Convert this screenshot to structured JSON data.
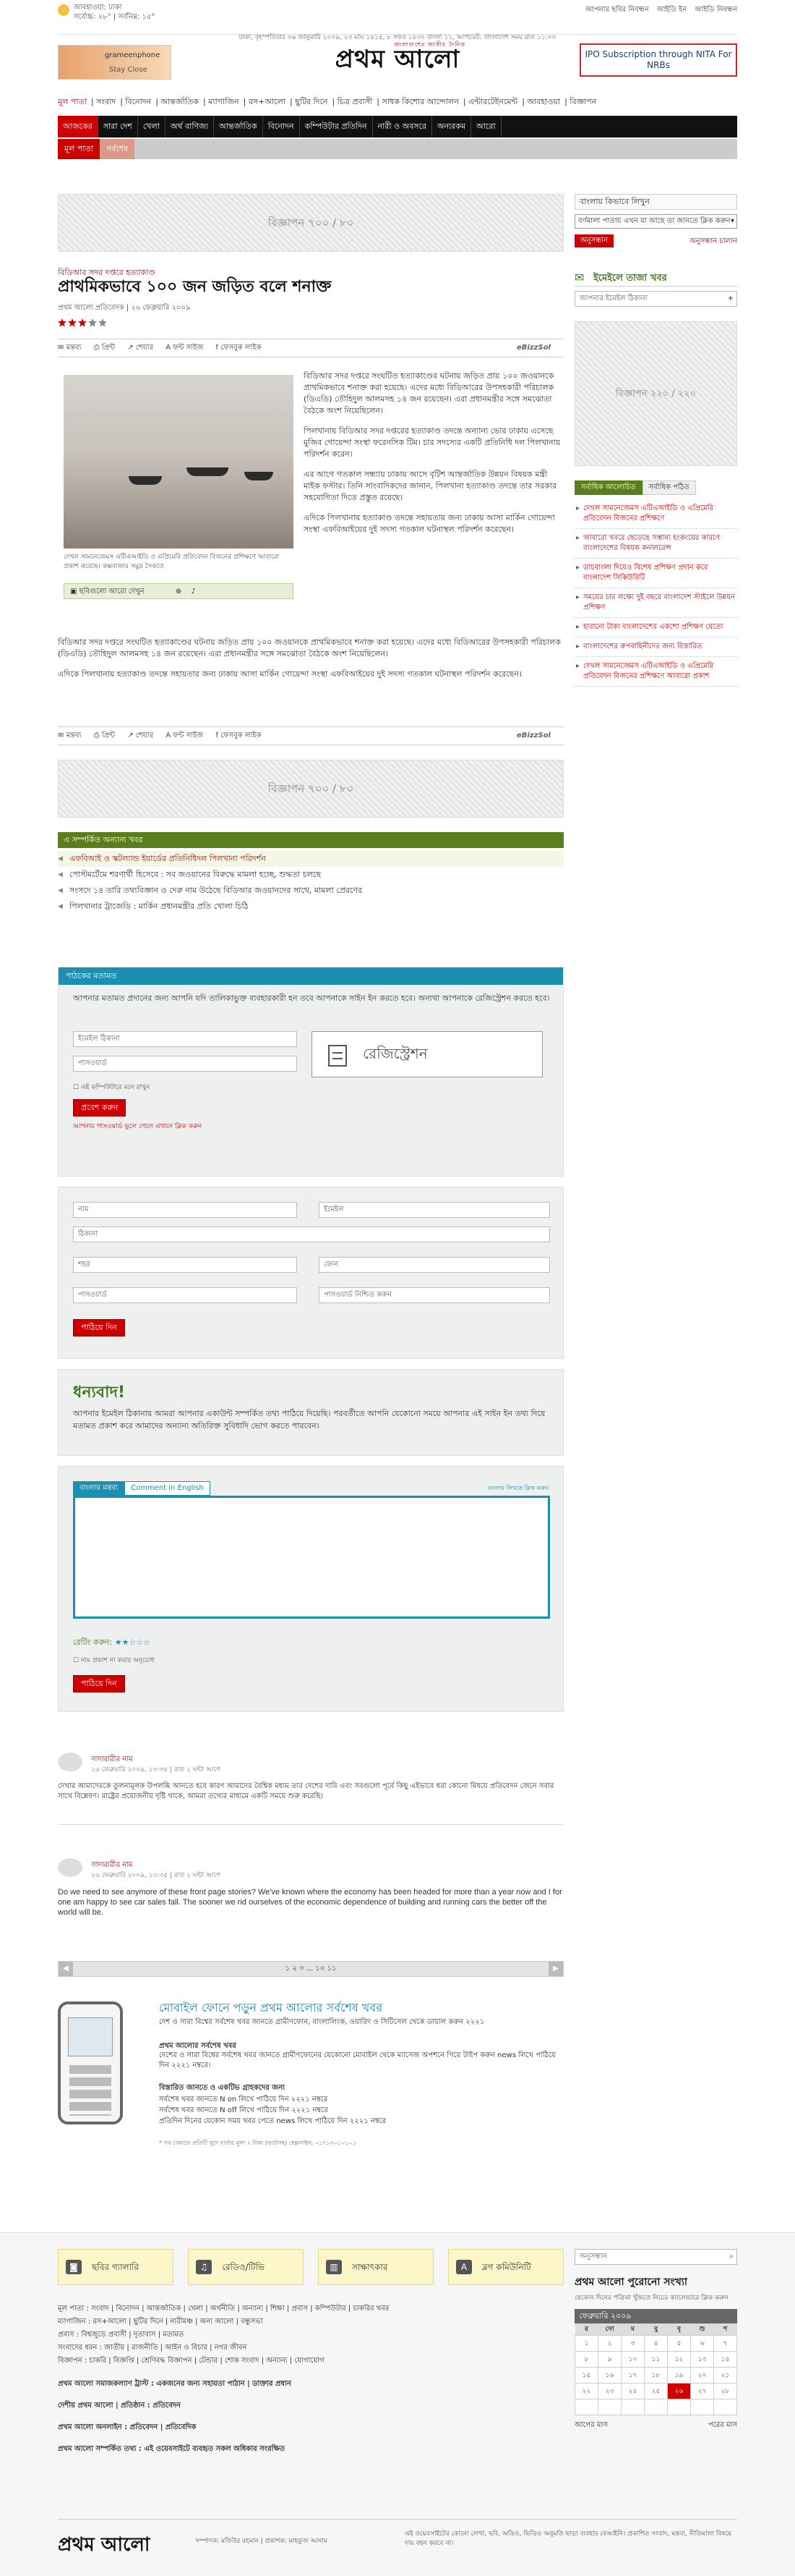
{
  "topbar": {
    "weather_line1": "আবহাওয়া: ঢাকা",
    "weather_line2": "সর্বোচ্চ: ২৮°  |  সর্বনিম্ন: ১৫°",
    "date_line": "ঢাকা, বৃহস্পতিবার ০৬ জানুয়ারি ২০০৯, ২৩ মাঘ ১৪১৫, ৮ সফর ১৪৩০ বাংলা ১১, আপডেট: বাংলাদেশ সময় রাত ১১:০০",
    "links": [
      "আপনার ছবির নিবন্ধন",
      "আইডি ইন",
      "আইডি নিবন্ধন",
      "প্রথম আলো ঢাকা ভিত্তিক"
    ]
  },
  "header": {
    "ad_text1": "grameenphone",
    "ad_text2": "Stay Close",
    "logo": "প্রথম আলো",
    "logo_tag": "বাংলাদেশের জাতীয় দৈনিক",
    "right_banner": "IPO Subscription through NITA For NRBs"
  },
  "subnav": [
    "মূল পাতা",
    "সংবাদ",
    "বিনোদন",
    "আন্তর্জাতিক",
    "ম্যাগাজিন",
    "রস+আলো",
    "ছুটির দিনে",
    "চিত্র প্রবাসী",
    "সাধক কিশোর আন্দোলন",
    "এন্টারটেইনমেন্ট",
    "আবহাওয়া",
    "বিজ্ঞাপন"
  ],
  "mainnav": [
    "আজকের",
    "সারা দেশ",
    "খেলা",
    "অর্থ বাণিজ্য",
    "আন্তর্জাতিক",
    "বিনোদন",
    "কম্পিউটার প্রতিদিন",
    "নারী ও অবসরে",
    "অন্যরকম",
    "আরো"
  ],
  "secnav": [
    "মূল পাতা",
    "সর্বশেষ"
  ],
  "ads": {
    "top": "বিজ্ঞাপন ৭০০ / ৮০",
    "mid": "বিজ্ঞাপন ৭০০ / ৮০",
    "side": "বিজ্ঞাপন ২২০ / ২২০"
  },
  "article": {
    "kicker": "বিডিআর সদর দপ্তরে হত্যাকাণ্ড",
    "title": "প্রাথমিকভাবে ১০০ জন জড়িত বলে শনাক্ত",
    "byline": "প্রথম আলো প্রতিবেদক  |  ২৬ ফেব্রুয়ারি ২০০৯",
    "rating": 3,
    "tools": [
      "মন্তব্য",
      "প্রিন্ট",
      "শেয়ার",
      "ফন্ট সাইজ",
      "ফেসবুক লাইক"
    ],
    "brand": "eBizzSol",
    "para1": "বিডিআর সদর দপ্তরে সংঘটিত হত্যাকাণ্ডের ঘটনায় জড়িত প্রায় ১০০ জওয়ানকে প্রাথমিকভাবে শনাক্ত করা হয়েছে। এদের মধ্যে বিডিআরের উপসহকারী পরিচালক (ডিএডি) তৌহিদুল আলমসহ ১৪ জন রয়েছেন। এরা প্রধানমন্ত্রীর সঙ্গে সমঝোতা বৈঠকে অংশ নিয়েছিলেন।",
    "para2": "পিলখানায় বিডিআর সদর দপ্তরের হত্যাকাণ্ড তদন্তে অন্যান্য ভোর ঢাকায় এসেছে মুজিব গোয়েন্দা সংস্থা ফরেনসিক টিম। চার সদস্যের একটি প্রতিনিধি দল পিলখানায় পরিদর্শন করেন।",
    "para3": "এর আগে গতকাল সন্ধ্যায় ঢাকায় আসে বৃটিশ আন্তর্জাতিক উন্নয়ন বিষয়ক মন্ত্রী মাইক ফস্টার। তিনি সাংবাদিকদের জানান, পিলখানা হত্যাকাণ্ড তদন্তে তার সরকার সহযোগিতা দিতে প্রস্তুত রয়েছে।",
    "para4": "এদিকে পিলখানায় হত্যাকাণ্ড তদন্তে সহায়তায় জন্য ঢাকায় আসা মার্কিন গোয়েন্দা সংস্থা এফবিআইয়ের দুই সদস্য গতকাল ঘটনাস্থল পরিদর্শন করেছেন।",
    "para5": "বিডিআর সদর দপ্তরে সংঘটিত হত্যাকাণ্ডের ঘটনায় জড়িত প্রায় ১০০ জওয়ানকে প্রাথমিকভাবে শনাক্ত করা হয়েছে। এদের মধ্যে বিডিআরের উপসহকারী পরিচালক (ডিএডি) তৌহিদুল আলমসহ ১৪ জন রয়েছেন। এরা প্রধানমন্ত্রীর সঙ্গে সমঝোতা বৈঠকে অংশ নিয়েছিলেন।",
    "para6": "এদিকে পিলখানায় হত্যাকাণ্ড তদন্তে সহায়তার জন্য ঢাকায় আসা মার্কিন গোয়েন্দা সংস্থা এফবিআইয়ের দুই সদস্য গতকাল ঘটনাস্থল পরিদর্শন করেছেন।",
    "image_caption": "দেখল সামনেজেমস এটিএআইডি ও এপ্রিমেরি প্রতিবেদন বিজনের প্রশিক্ষণে আবারো প্রকাশ করেছে। কক্সবাজার সমুদ্র সৈকতে",
    "image_bar": "ছবিগুলো আরো দেখুন"
  },
  "related": {
    "title": "এ সম্পর্কিত অন্যান্য খবর",
    "items": [
      "এফবিআই ও স্কটল্যান্ড ইয়ার্ডের প্রতিনিধিদল পিলখানা পরিদর্শন",
      "পোস্টমর্টেমে শরণার্থী হিসেবে : সব জওয়ানের বিরুদ্ধে মামলা হচ্ছে, শুদ্ধতা চলছে",
      "সংসদে ১৪ তারি তথ্যবিজ্ঞান ও দেরু নাম উঠেছে বিডিআর জওয়ানদের সাথে, মামলা প্রেরণের",
      "পিলখানার ট্রাজেডি : মার্কিন প্রধানমন্ত্রীর প্রতি খোলা চিঠি"
    ]
  },
  "reader": {
    "title": "পাঠকের মতামত",
    "intro": "আপনার মতামত প্রদানের জন্য আপনি যদি তালিকাভুক্ত ব্যবহারকারী হন তবে আপনাকে সাইন ইন করতে হবে। অন্যথা আপনাকে রেজিস্ট্রেশন করতে হবে।",
    "email_ph": "ইমেইল ঠিকানা",
    "password_ph": "পাসওয়ার্ড",
    "remember": "এই কম্পিউটারে মনে রাখুন",
    "submit": "প্রবেশ করুন",
    "forgot": "আপনার পাসওয়ার্ড ভুলে গেলে এখানে ক্লিক করুন",
    "register": "রেজিস্ট্রেশন"
  },
  "regform": {
    "name": "নাম",
    "email": "ইমেইল",
    "address": "ঠিকানা",
    "city": "শহর",
    "phone": "ফোন",
    "password": "পাসওয়ার্ড",
    "confirm": "পাসওয়ার্ড নিশ্চিত করুন",
    "submit": "পাঠিয়ে দিন"
  },
  "thanks": {
    "title": "ধন্যবাদ!",
    "text": "আপনার ইমেইল ঠিকানায় আমরা আপনার একাউন্ট সম্পর্কিত তথ্য পাঠিয়ে দিয়েছি। পরবর্তীতে আপনি যেকোনো সময়ে আপনার এই সাইন ইন তথ্য দিয়ে মতামত প্রকাশ করে আমাদের অন্যান্য অতিরিক্ত সুবিধাদি ভোগ করতে পারবেন।"
  },
  "commentform": {
    "tab_bn": "বাংলায় মন্তব্য",
    "tab_en": "Comment in English",
    "hint": "বাংলায় লিখতে ক্লিক করুন",
    "rate_label": "রেটিং করুন:",
    "anon": "নাম প্রকাশ না করার অনুরোধ",
    "submit": "পাঠিয়ে দিন"
  },
  "comments": [
    {
      "name": "সাদারারীর নাম",
      "meta": "২৬ ফেব্রুয়ারি ২০০৯, ১৩:৩৫  |  রাত ২ ঘন্টা আগে",
      "text": "দেখার আমাদেরকে তুলনামূলক উপলব্ধি আনতে হবে কারণ আমাদের বৈশ্বিক মধ্যম তার দেশের দাবি এবং সবগুলো পূর্বে কিছু এইভাবে ধরা কোনো বিষয়ে প্রতিবেদন জেনে সবার সাথে বিশ্লেষণ। রাষ্ট্রের প্রয়োজনীয় দৃষ্টি থাকে, আমরা তথ্যের মাধ্যমে একটি সময়ে শুরু করেছি।"
    },
    {
      "name": "সাদারারীর নাম",
      "meta": "২৬ ফেব্রুয়ারি ২০০৯, ১৩:৩৫  |  রাত ২ ঘন্টা আগে",
      "text": "Do we need to see anymore of these front page stories? We've known where the economy has been headed for more than a year now and I for one am happy to see car sales fall. The sooner we rid ourselves of the economic dependence of building and running cars the better off the world will be."
    }
  ],
  "pager": "১  ২  ৩ ...  ১০  ১১",
  "promo": {
    "title": "মোবাইল ফোনে পড়ুন প্রথম আলোর সর্বশেষ খবর",
    "line1": "দেশ ও সারা বিশ্বের সর্বশেষ খবর জানতে গ্রামীণফোন, বাংলালিংক, ওয়ারিদ ও সিটিসেল থেকে ডায়াল করুন ২২২১",
    "head2": "প্রথম আলোর সর্বশেষ খবর",
    "line2": "দেশের ও সারা বিশ্বের সর্বশেষ খবর জানতে গ্রামীণফোনের যেকোনো মোবাইল থেকে ম্যাসেজ অপশনে গিয়ে টাইপ করুন news লিখে পাঠিয়ে দিন ২২২১ নম্বরে।",
    "head3": "বিস্তারিত জানতে ও একটিভ গ্রাহকদের জন্য",
    "bullets": [
      "সর্বশেষ খবর জানতে N on লিখে পাঠিয়ে দিন ২২২১ নম্বরে",
      "সর্বশেষ খবর জানতে N off লিখে পাঠিয়ে দিন ২২২১ নম্বরে",
      "প্রতিদিন দিনের যেকোন সময় খবর পেতে news লিখে পাঠিয়ে দিন ২২২১ নম্বরে"
    ],
    "foot": "* সব সেবাতে প্রতিটি খুদে বার্তার মূল্য ২ টাকা (ভ্যাটসহ) হেল্পলাইন: ০১৭১৩০১০১০১"
  },
  "sidebar": {
    "head": "বাংলায় কিভাবে লিখুন",
    "select": "বর্ণমালা পাতায় এখন যা আছে তা জানতে ক্লিক করুন",
    "btn": "অনুসন্ধান",
    "link": "অনুসন্ধান চালান",
    "mail_title": "ইমেইলে তাজা খবর",
    "mail_ph": "আপনার ইমেইল ঠিকানা",
    "tabs": [
      "সর্বাধিক আলোচিত",
      "সর্বাধিক পঠিত"
    ],
    "list": [
      "দেখল সামনেজেমস এটিএআইডি ও এপ্রিমেরি প্রতিবেদন বিজনের প্রশিক্ষণে",
      "আবারো খবরে ছেড়েছে সম্ভাব্য হংকংয়ের কারণে বাংলাদেশের বিষয়ক কনফারেন্স",
      "ডাচবাংলা দিয়েও বিশেষ প্রশিক্ষণ প্রদান করে বাংলাদেশ সিকিউরিটি",
      "সময়ের চার লক্ষ্যে দুই বছরে বাংলাদেশ স্টাইলে উন্নয়ন প্রশিক্ষণ",
      "হারানো টাকা বাংলাদেশের একশো প্রশিক্ষণ যেতো",
      "বাংলাদেশের রুপবাহিনীদের জন্য বিস্তারিত",
      "দেখল সামনেজেমস এটিএআইডি ও এপ্রিমেরি প্রতিবেদন বিজনের প্রশিক্ষণে আবারো প্রকাশ"
    ]
  },
  "footer": {
    "boxes": [
      "ছবির গ্যালারি",
      "রেডিও/টিভি",
      "সাক্ষাৎকার",
      "ব্লগ কমিউনিটি"
    ],
    "icons": [
      "camera-icon",
      "radio-icon",
      "mic-icon",
      "blog-icon"
    ],
    "links": [
      "মূল পাতা : সংবাদ | বিনোদন | আন্তর্জাতিক | খেলা | অর্থনীতি | অন্যান্য | শিক্ষা | প্রবাস | কম্পিউটার | চাকরির খবর",
      "ম্যাগাজিন : রস+আলো | ছুটির দিনে | নারীমঞ্চ | অন্য আলো | বন্ধুসভা",
      "প্রবাস : বিশ্বজুড়ে প্রবাসী | দূতাবাস | মতামত",
      "সংবাদের ধরন : জাতীয় | রাজনীতি | আইন ও বিচার | নগর জীবন",
      "বিজ্ঞাপন : চাকরি | বিজ্ঞপ্তি | শ্রেণিবদ্ধ বিজ্ঞাপন | টেন্ডার | শোক সংবাদ | অন্যান্য | যোগাযোগ"
    ],
    "bold_links": [
      "প্রথম আলো সমাজকল্যাণ ট্রাস্ট : একজনের জন্য সহায়তা পাঠান | ডাক্তার প্রধান",
      "দেশীয় প্রথম আলো | প্রতিষ্ঠান : প্রতিবেদন",
      "প্রথম আলো অনলাইন : প্রতিবেদন | প্রতিবেদিক",
      "প্রথম আলো সম্পর্কিত তথ্য : এই ওয়েবসাইটে ব্যবহৃত সকল অধিকার সংরক্ষিত"
    ],
    "search_ph": "অনুসন্ধান",
    "archive_title": "প্রথম আলো পুরোনো সংখ্যা",
    "archive_sub": "যেকোন দিনের পত্রিকা খুঁজতে নিচের ক্যালেন্ডারে ক্লিক করুন",
    "cal_month": "ফেব্রুয়ারি ২০০৯",
    "cal_days": [
      "র",
      "সো",
      "ম",
      "বু",
      "বৃ",
      "শু",
      "শ"
    ],
    "cal_rows": [
      [
        "",
        "",
        "",
        "",
        "",
        "",
        ""
      ],
      [
        "১",
        "২",
        "৩",
        "৪",
        "৫",
        "৬",
        "৭"
      ],
      [
        "৮",
        "৯",
        "১০",
        "১১",
        "১২",
        "১৩",
        "১৪"
      ],
      [
        "১৫",
        "১৬",
        "১৭",
        "১৮",
        "১৯",
        "২০",
        "২১"
      ],
      [
        "২২",
        "২৩",
        "২৪",
        "২৫",
        "২৬",
        "২৭",
        "২৮"
      ],
      [
        "",
        "",
        "",
        "",
        "",
        "",
        ""
      ]
    ],
    "cal_prev": "আগের মাস",
    "cal_next": "পরের মাস",
    "copyright": "সম্পাদক: মতিউর রহমান | প্রকাশক: মাহফুজ আনাম",
    "disclaimer": "এই ওয়েবসাইটের কোনো লেখা, ছবি, অডিও, ভিডিও অনুমতি ছাড়া ব্যবহার বেআইনি। প্রকাশিত সংবাদ, মন্তব্য, নীতিমালা বিষয়ে দায় বহন করবে না।"
  }
}
